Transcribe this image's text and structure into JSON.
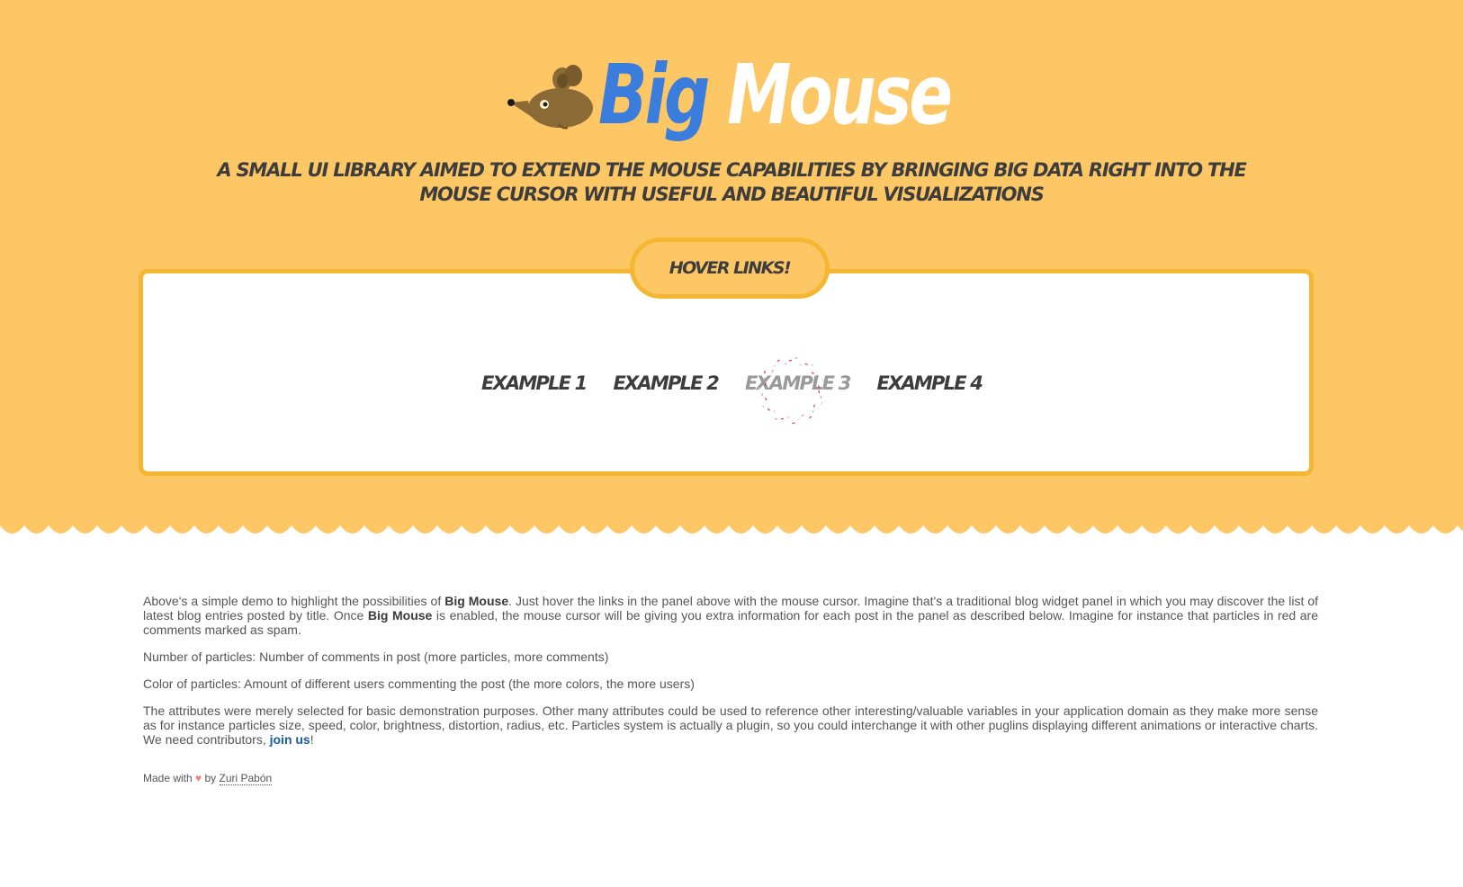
{
  "header": {
    "logo_big": "Big",
    "logo_mouse": "Mouse",
    "tagline": "A small UI library aimed to extend the mouse capabilities by bringing big data right into the mouse cursor with useful and beautiful visualizations"
  },
  "panel": {
    "tab_label": "Hover links!",
    "links": [
      "Example 1",
      "Example 2",
      "Example 3",
      "Example 4"
    ],
    "hovered_index": 2
  },
  "content": {
    "p1_a": "Above's a simple demo to highlight the possibilities of ",
    "p1_b": "Big Mouse",
    "p1_c": ". Just hover the links in the panel above with the mouse cursor. Imagine that's a traditional blog widget panel in which you may discover the list of latest blog entries posted by title. Once ",
    "p1_d": "Big Mouse",
    "p1_e": " is enabled, the mouse cursor will be giving you extra information for each post in the panel as described below. Imagine for instance that particles in red are comments marked as spam.",
    "p2": "Number of particles: Number of comments in post (more particles, more comments)",
    "p3": "Color of particles: Amount of different users commenting the post (the more colors, the more users)",
    "p4_a": "The attributes were merely selected for basic demonstration purposes. Other many attributes could be used to reference other interesting/valuable variables in your application domain as they make more sense as for instance particles size, speed, color, brightness, distortion, radius, etc. Particles system is actually a plugin, so you could interchange it with other puglins displaying different animations or interactive charts. We need contributors, ",
    "p4_link": "join us",
    "p4_b": "!"
  },
  "footer": {
    "made_with": "Made with ",
    "heart": "♥",
    "by": " by ",
    "author": "Zuri Pabón"
  },
  "colors": {
    "hero_bg": "#fec766",
    "border": "#f5b731",
    "logo_blue": "#3b7ddd",
    "particle_pink": "#e0267a"
  },
  "icons": {
    "logo_mascot": "mouse-mascot-icon"
  }
}
